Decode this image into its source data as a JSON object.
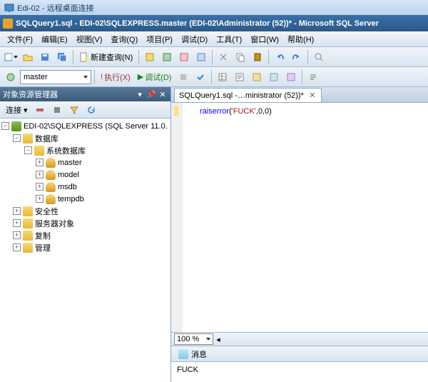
{
  "rdp": {
    "title": "Edi-02 - 远程桌面连接"
  },
  "app": {
    "title": "SQLQuery1.sql - EDI-02\\SQLEXPRESS.master (EDI-02\\Administrator (52))* - Microsoft SQL Server"
  },
  "menu": {
    "file": "文件(F)",
    "edit": "编辑(E)",
    "view": "视图(V)",
    "query": "查询(Q)",
    "project": "项目(P)",
    "debug": "调试(D)",
    "tools": "工具(T)",
    "window": "窗口(W)",
    "help": "帮助(H)"
  },
  "toolbar": {
    "new_query": "新建查询(N)",
    "execute": "执行(X)",
    "debug": "调试(D)",
    "db_selected": "master"
  },
  "sidebar": {
    "title": "对象资源管理器",
    "connect": "连接 ▾",
    "tree": {
      "server": "EDI-02\\SQLEXPRESS (SQL Server 11.0.",
      "databases": "数据库",
      "system_db": "系统数据库",
      "dbs": [
        "master",
        "model",
        "msdb",
        "tempdb"
      ],
      "security": "安全性",
      "server_objects": "服务器对象",
      "replication": "复制",
      "management": "管理"
    }
  },
  "editor": {
    "tab": "SQLQuery1.sql -…ministrator (52))*",
    "code_kw": "raiserror",
    "code_paren1": "(",
    "code_str": "'FUCK'",
    "code_rest": ",0,0)",
    "zoom": "100 %"
  },
  "results": {
    "tab": "消息",
    "output": "FUCK"
  }
}
